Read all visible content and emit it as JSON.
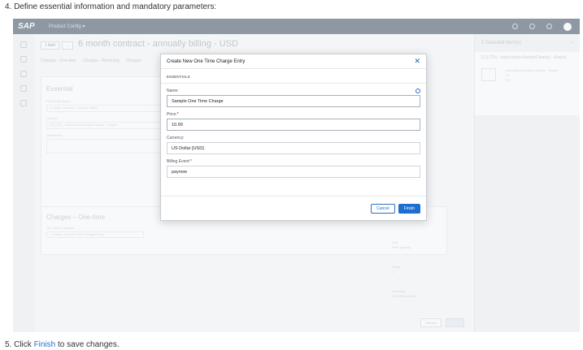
{
  "instructions": {
    "step4": "4. Define essential information and mandatory parameters:",
    "step5_prefix": "5. Click ",
    "step5_link": "Finish",
    "step5_suffix": " to save changes."
  },
  "shell": {
    "logo": "SAP",
    "product": "Product Config ▾"
  },
  "background": {
    "headline": "6 month contract - annually billing - USD",
    "chips": [
      "1 Add",
      "..."
    ],
    "tabs": [
      "Charges - One-time",
      "Charges - Recurring",
      "Charges"
    ],
    "essential_title": "Essential",
    "price_plan_label": "Price Plan Name",
    "price_plan_value": "6 month contract - annually billing",
    "product_label": "Product",
    "product_value": "[11] [TD] - subscriptionSampleCatalog - Staged",
    "description_label": "Description",
    "charges_title": "Charges – One-time",
    "one_time_label": "One-Time Charges",
    "one_time_link": "+ Create new One Time Charge Entry",
    "side_header": "1 Selected Item(s)",
    "side_item_title": "[11] [TD] - subscriptionSampleCatalog - Staged",
    "side_item_meta": [
      "subscriptionSampleCatalog - Staged",
      "TD",
      "[11]"
    ],
    "detail_col": [
      "Unit",
      "Price (pcs/m)",
      "Scale",
      "1",
      "Currency",
      "US Dollar (USD)"
    ],
    "footer_buttons": [
      "Refresh",
      "Finish"
    ]
  },
  "dialog": {
    "title": "Create New One Time Charge Entry",
    "section": "ESSENTIALS",
    "fields": {
      "name": {
        "label": "Name:",
        "value": "Sample One Time Charge"
      },
      "price": {
        "label": "Price:",
        "value": "10.99"
      },
      "currency": {
        "label": "Currency:",
        "value": "US Dollar [USD]"
      },
      "billing_event": {
        "label": "Billing Event:",
        "value": "paynow"
      }
    },
    "required_marker": "*",
    "cancel_label": "Cancel",
    "finish_label": "Finish"
  }
}
